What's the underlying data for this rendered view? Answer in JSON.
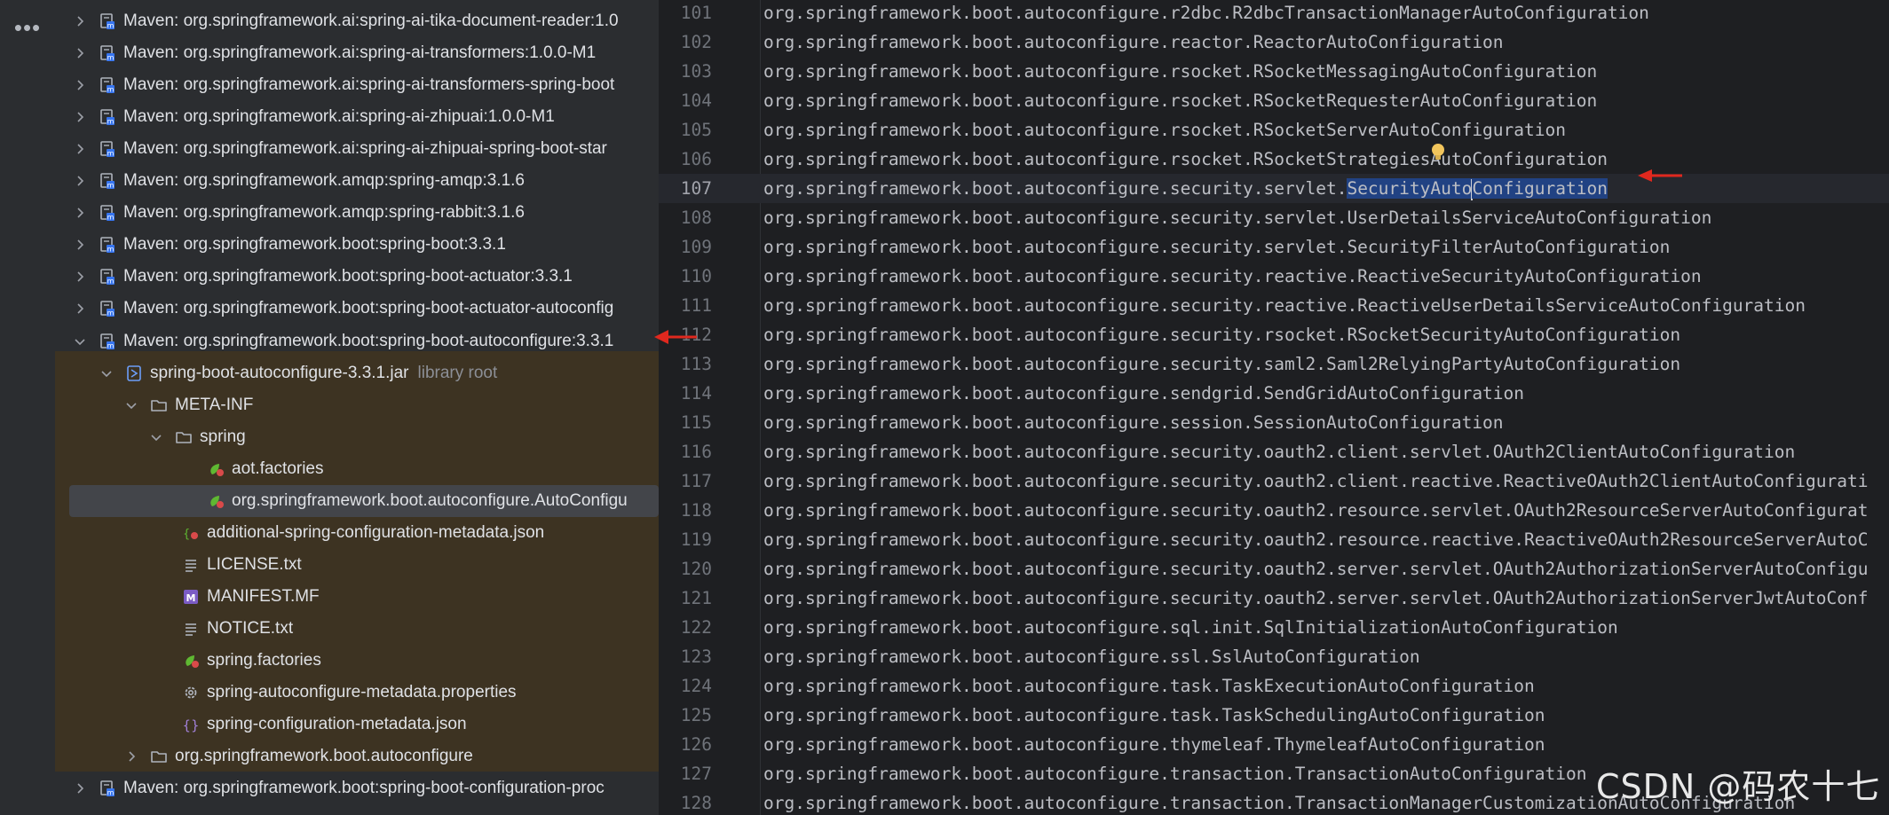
{
  "activity_bar": {
    "more_icon": "more-horizontal-icon"
  },
  "tree": {
    "rows": [
      {
        "label": "Maven: org.springframework.ai:spring-ai-tika-document-reader:1.0",
        "suffix": "",
        "icon": "library-icon",
        "chevron": "right"
      },
      {
        "label": "Maven: org.springframework.ai:spring-ai-transformers:1.0.0-M1",
        "suffix": "",
        "icon": "library-icon",
        "chevron": "right"
      },
      {
        "label": "Maven: org.springframework.ai:spring-ai-transformers-spring-boot",
        "suffix": "",
        "icon": "library-icon",
        "chevron": "right"
      },
      {
        "label": "Maven: org.springframework.ai:spring-ai-zhipuai:1.0.0-M1",
        "suffix": "",
        "icon": "library-icon",
        "chevron": "right"
      },
      {
        "label": "Maven: org.springframework.ai:spring-ai-zhipuai-spring-boot-star",
        "suffix": "",
        "icon": "library-icon",
        "chevron": "right"
      },
      {
        "label": "Maven: org.springframework.amqp:spring-amqp:3.1.6",
        "suffix": "",
        "icon": "library-icon",
        "chevron": "right"
      },
      {
        "label": "Maven: org.springframework.amqp:spring-rabbit:3.1.6",
        "suffix": "",
        "icon": "library-icon",
        "chevron": "right"
      },
      {
        "label": "Maven: org.springframework.boot:spring-boot:3.3.1",
        "suffix": "",
        "icon": "library-icon",
        "chevron": "right"
      },
      {
        "label": "Maven: org.springframework.boot:spring-boot-actuator:3.3.1",
        "suffix": "",
        "icon": "library-icon",
        "chevron": "right"
      },
      {
        "label": "Maven: org.springframework.boot:spring-boot-actuator-autoconfig",
        "suffix": "",
        "icon": "library-icon",
        "chevron": "right"
      },
      {
        "label": "Maven: org.springframework.boot:spring-boot-autoconfigure:3.3.1",
        "suffix": "",
        "icon": "library-icon",
        "chevron": "down"
      },
      {
        "label": "spring-boot-autoconfigure-3.3.1.jar",
        "suffix": "library root",
        "icon": "jar-icon",
        "chevron": "down"
      },
      {
        "label": "META-INF",
        "suffix": "",
        "icon": "folder-icon",
        "chevron": "down"
      },
      {
        "label": "spring",
        "suffix": "",
        "icon": "folder-icon",
        "chevron": "down"
      },
      {
        "label": "aot.factories",
        "suffix": "",
        "icon": "spring-file-icon",
        "chevron": ""
      },
      {
        "label": "org.springframework.boot.autoconfigure.AutoConfigu",
        "suffix": "",
        "icon": "spring-file-icon",
        "chevron": ""
      },
      {
        "label": "additional-spring-configuration-metadata.json",
        "suffix": "",
        "icon": "spring-json-icon",
        "chevron": ""
      },
      {
        "label": "LICENSE.txt",
        "suffix": "",
        "icon": "text-file-icon",
        "chevron": ""
      },
      {
        "label": "MANIFEST.MF",
        "suffix": "",
        "icon": "manifest-icon",
        "chevron": ""
      },
      {
        "label": "NOTICE.txt",
        "suffix": "",
        "icon": "text-file-icon",
        "chevron": ""
      },
      {
        "label": "spring.factories",
        "suffix": "",
        "icon": "spring-file-icon",
        "chevron": ""
      },
      {
        "label": "spring-autoconfigure-metadata.properties",
        "suffix": "",
        "icon": "gear-icon",
        "chevron": ""
      },
      {
        "label": "spring-configuration-metadata.json",
        "suffix": "",
        "icon": "json-braces-icon",
        "chevron": ""
      },
      {
        "label": "org.springframework.boot.autoconfigure",
        "suffix": "",
        "icon": "folder-icon",
        "chevron": "right"
      },
      {
        "label": "Maven: org.springframework.boot:spring-boot-configuration-proc",
        "suffix": "",
        "icon": "library-icon",
        "chevron": "right"
      }
    ]
  },
  "editor": {
    "lines": [
      {
        "n": "101",
        "text": "org.springframework.boot.autoconfigure.r2dbc.R2dbcTransactionManagerAutoConfiguration"
      },
      {
        "n": "102",
        "text": "org.springframework.boot.autoconfigure.reactor.ReactorAutoConfiguration"
      },
      {
        "n": "103",
        "text": "org.springframework.boot.autoconfigure.rsocket.RSocketMessagingAutoConfiguration"
      },
      {
        "n": "104",
        "text": "org.springframework.boot.autoconfigure.rsocket.RSocketRequesterAutoConfiguration"
      },
      {
        "n": "105",
        "text": "org.springframework.boot.autoconfigure.rsocket.RSocketServerAutoConfiguration"
      },
      {
        "n": "106",
        "text": "org.springframework.boot.autoconfigure.rsocket.RSocketStrategiesAutoConfiguration"
      },
      {
        "n": "107",
        "text": "org.springframework.boot.autoconfigure.security.servlet.",
        "sel": "SecurityAuto",
        "sel2": "Configuration"
      },
      {
        "n": "108",
        "text": "org.springframework.boot.autoconfigure.security.servlet.UserDetailsServiceAutoConfiguration"
      },
      {
        "n": "109",
        "text": "org.springframework.boot.autoconfigure.security.servlet.SecurityFilterAutoConfiguration"
      },
      {
        "n": "110",
        "text": "org.springframework.boot.autoconfigure.security.reactive.ReactiveSecurityAutoConfiguration"
      },
      {
        "n": "111",
        "text": "org.springframework.boot.autoconfigure.security.reactive.ReactiveUserDetailsServiceAutoConfiguration"
      },
      {
        "n": "112",
        "text": "org.springframework.boot.autoconfigure.security.rsocket.RSocketSecurityAutoConfiguration"
      },
      {
        "n": "113",
        "text": "org.springframework.boot.autoconfigure.security.saml2.Saml2RelyingPartyAutoConfiguration"
      },
      {
        "n": "114",
        "text": "org.springframework.boot.autoconfigure.sendgrid.SendGridAutoConfiguration"
      },
      {
        "n": "115",
        "text": "org.springframework.boot.autoconfigure.session.SessionAutoConfiguration"
      },
      {
        "n": "116",
        "text": "org.springframework.boot.autoconfigure.security.oauth2.client.servlet.OAuth2ClientAutoConfiguration"
      },
      {
        "n": "117",
        "text": "org.springframework.boot.autoconfigure.security.oauth2.client.reactive.ReactiveOAuth2ClientAutoConfigurati"
      },
      {
        "n": "118",
        "text": "org.springframework.boot.autoconfigure.security.oauth2.resource.servlet.OAuth2ResourceServerAutoConfigurat"
      },
      {
        "n": "119",
        "text": "org.springframework.boot.autoconfigure.security.oauth2.resource.reactive.ReactiveOAuth2ResourceServerAutoC"
      },
      {
        "n": "120",
        "text": "org.springframework.boot.autoconfigure.security.oauth2.server.servlet.OAuth2AuthorizationServerAutoConfigu"
      },
      {
        "n": "121",
        "text": "org.springframework.boot.autoconfigure.security.oauth2.server.servlet.OAuth2AuthorizationServerJwtAutoConf"
      },
      {
        "n": "122",
        "text": "org.springframework.boot.autoconfigure.sql.init.SqlInitializationAutoConfiguration"
      },
      {
        "n": "123",
        "text": "org.springframework.boot.autoconfigure.ssl.SslAutoConfiguration"
      },
      {
        "n": "124",
        "text": "org.springframework.boot.autoconfigure.task.TaskExecutionAutoConfiguration"
      },
      {
        "n": "125",
        "text": "org.springframework.boot.autoconfigure.task.TaskSchedulingAutoConfiguration"
      },
      {
        "n": "126",
        "text": "org.springframework.boot.autoconfigure.thymeleaf.ThymeleafAutoConfiguration"
      },
      {
        "n": "127",
        "text": "org.springframework.boot.autoconfigure.transaction.TransactionAutoConfiguration"
      },
      {
        "n": "128",
        "text": "org.springframework.boot.autoconfigure.transaction.TransactionManagerCustomizationAutoConfiguration"
      }
    ]
  },
  "annotations": {
    "arrow_color": "#e0281e",
    "arrow_icon": "red-arrow-icon"
  },
  "watermark": "CSDN @码农十七"
}
